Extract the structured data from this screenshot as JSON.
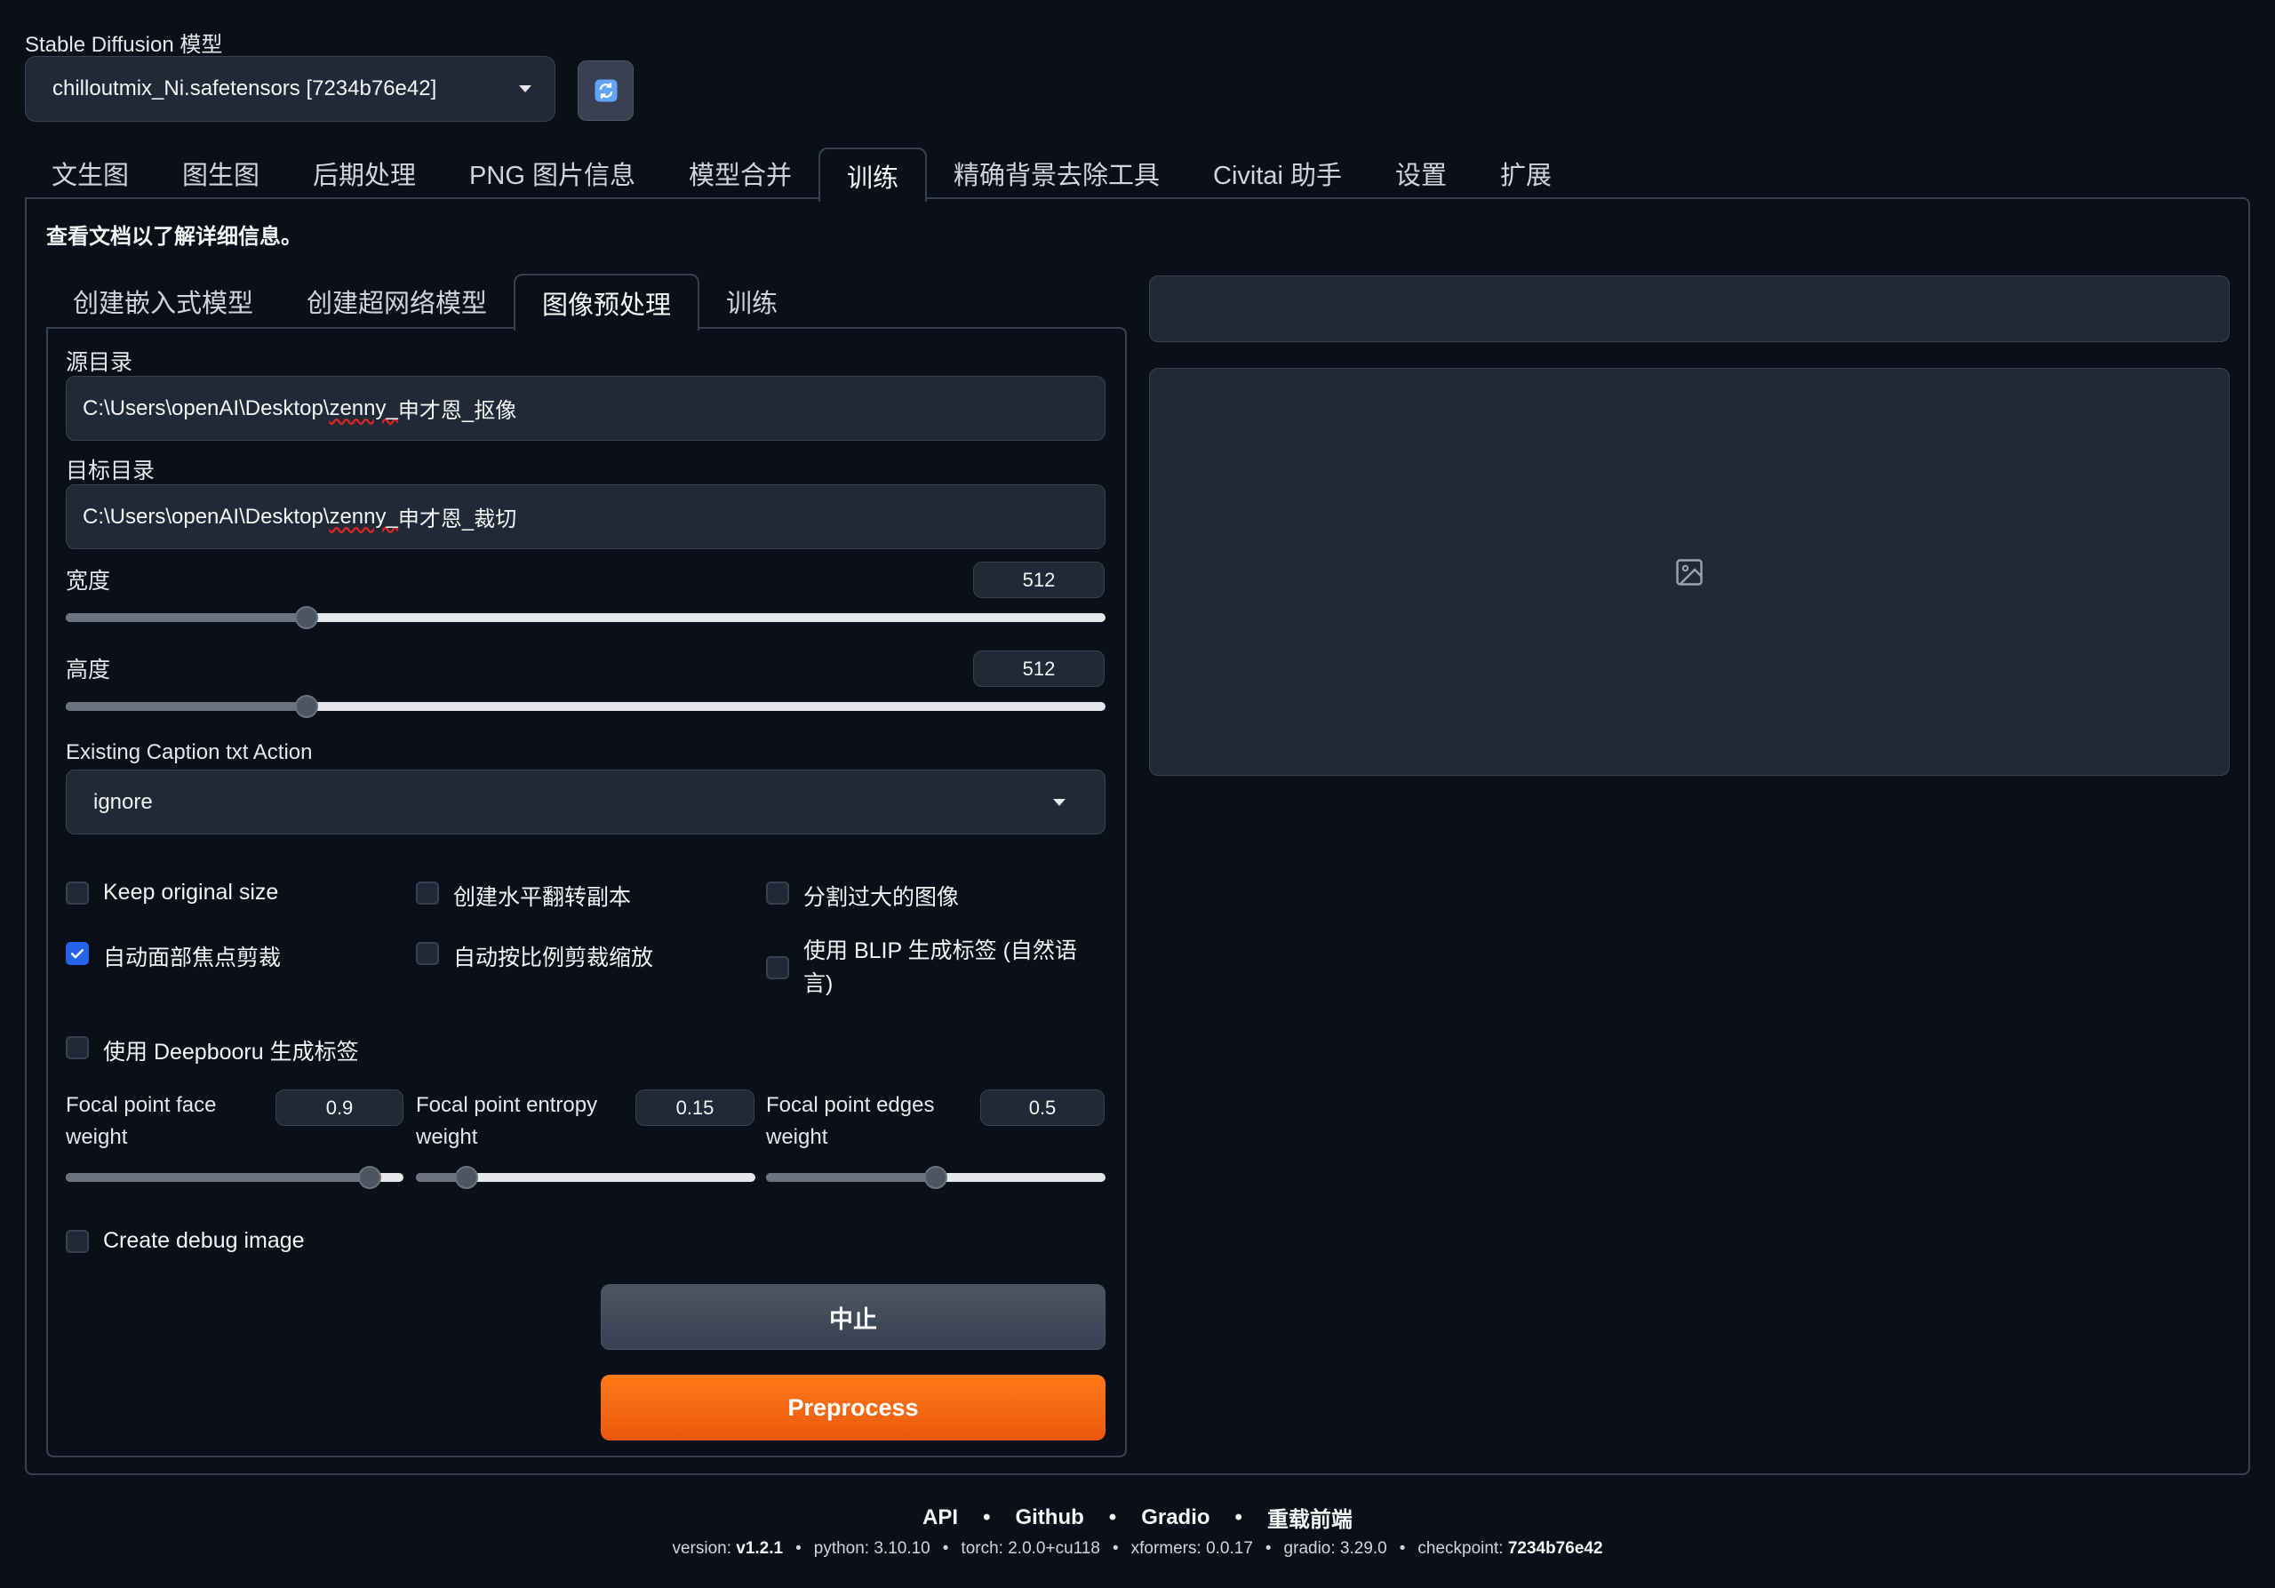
{
  "model": {
    "label": "Stable Diffusion 模型",
    "selected": "chilloutmix_Ni.safetensors [7234b76e42]"
  },
  "top_tabs": [
    "文生图",
    "图生图",
    "后期处理",
    "PNG 图片信息",
    "模型合并",
    "训练",
    "精确背景去除工具",
    "Civitai 助手",
    "设置",
    "扩展"
  ],
  "top_tab_active": "训练",
  "doc_note": "查看文档以了解详细信息。",
  "sub_tabs": [
    "创建嵌入式模型",
    "创建超网络模型",
    "图像预处理",
    "训练"
  ],
  "sub_tab_active": "图像预处理",
  "source_dir": {
    "label": "源目录",
    "prefix": "C:\\Users\\openAI\\Desktop\\",
    "underlined": "zenny_",
    "suffix": "申才恩_抠像"
  },
  "target_dir": {
    "label": "目标目录",
    "prefix": "C:\\Users\\openAI\\Desktop\\",
    "underlined": "zenny_",
    "suffix": "申才恩_裁切"
  },
  "width": {
    "label": "宽度",
    "value": "512",
    "fraction": 0.232
  },
  "height": {
    "label": "高度",
    "value": "512",
    "fraction": 0.232
  },
  "caption_action": {
    "label": "Existing Caption txt Action",
    "selected": "ignore"
  },
  "checkboxes": {
    "keep_original_size": {
      "label": "Keep original size",
      "checked": false
    },
    "create_flipped": {
      "label": "创建水平翻转副本",
      "checked": false
    },
    "split_oversized": {
      "label": "分割过大的图像",
      "checked": false
    },
    "auto_focal_crop": {
      "label": "自动面部焦点剪裁",
      "checked": true
    },
    "auto_sized_crop": {
      "label": "自动按比例剪裁缩放",
      "checked": false
    },
    "use_blip": {
      "label": "使用 BLIP 生成标签 (自然语言)",
      "checked": false
    },
    "use_deepbooru": {
      "label": "使用 Deepbooru 生成标签",
      "checked": false
    },
    "create_debug": {
      "label": "Create debug image",
      "checked": false
    }
  },
  "focal": {
    "face": {
      "label": "Focal point face weight",
      "value": "0.9",
      "fraction": 0.9
    },
    "entropy": {
      "label": "Focal point entropy weight",
      "value": "0.15",
      "fraction": 0.15
    },
    "edges": {
      "label": "Focal point edges weight",
      "value": "0.5",
      "fraction": 0.5
    }
  },
  "buttons": {
    "stop": "中止",
    "preprocess": "Preprocess"
  },
  "footer": {
    "links": [
      "API",
      "Github",
      "Gradio",
      "重载前端"
    ],
    "versions": [
      {
        "key": "version: ",
        "value": "v1.2.1",
        "bold": true
      },
      {
        "key": "python: ",
        "value": "3.10.10",
        "bold": false
      },
      {
        "key": "torch: ",
        "value": "2.0.0+cu118",
        "bold": false
      },
      {
        "key": "xformers: ",
        "value": "0.0.17",
        "bold": false
      },
      {
        "key": "gradio: ",
        "value": "3.29.0",
        "bold": false
      },
      {
        "key": "checkpoint: ",
        "value": "7234b76e42",
        "bold": true
      }
    ]
  },
  "colors": {
    "background": "#0b0f19",
    "panel": "#1f2937",
    "border": "#374151",
    "accent_orange": "#ea580c",
    "checkbox_blue": "#2563eb"
  },
  "icons": {
    "refresh": "refresh-icon",
    "image_placeholder": "image-icon",
    "checkmark": "check-icon",
    "dropdown_caret": "chevron-down-icon"
  }
}
